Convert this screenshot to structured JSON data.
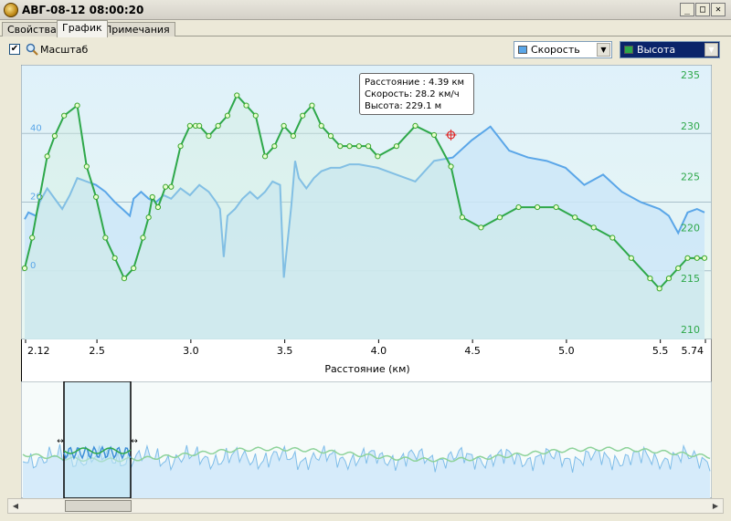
{
  "window": {
    "title": "АВГ-08-12 08:00:20"
  },
  "tabs": [
    {
      "label": "Свойства",
      "active": false
    },
    {
      "label": "График",
      "active": true
    },
    {
      "label": "Примечания",
      "active": false
    }
  ],
  "toolbar": {
    "scale_checked": true,
    "scale_label": "Масштаб",
    "speed_select": "Скорость",
    "height_select": "Высота"
  },
  "colors": {
    "speed": "#5aa6e8",
    "height": "#2ea84a",
    "bg_top": "#dff1fa",
    "bg_bottom": "#e9f7f2"
  },
  "tooltip": {
    "distance": "Расстояние : 4.39 км",
    "speed": "Скорость: 28.2 км/ч",
    "height": "Высота: 229.1 м"
  },
  "chart_data": {
    "type": "line",
    "xlabel": "Расстояние  (км)",
    "xlim": [
      2.12,
      5.74
    ],
    "x_ticks": [
      "2.12",
      "2.5",
      "3.0",
      "3.5",
      "4.0",
      "4.5",
      "5.0",
      "5.5",
      "5.74"
    ],
    "y_left_ticks": [
      "40",
      "20",
      "0"
    ],
    "y_right_ticks": [
      "235",
      "230",
      "225",
      "220",
      "215",
      "210"
    ],
    "y_left_lim": [
      -20,
      60
    ],
    "y_right_lim": [
      209,
      236
    ],
    "series": [
      {
        "name": "Скорость",
        "axis": "left",
        "x": [
          2.12,
          2.14,
          2.18,
          2.2,
          2.24,
          2.28,
          2.32,
          2.36,
          2.4,
          2.45,
          2.5,
          2.55,
          2.6,
          2.64,
          2.68,
          2.7,
          2.74,
          2.78,
          2.82,
          2.86,
          2.9,
          2.95,
          3.0,
          3.05,
          3.1,
          3.14,
          3.16,
          3.18,
          3.2,
          3.24,
          3.28,
          3.32,
          3.36,
          3.4,
          3.44,
          3.48,
          3.5,
          3.54,
          3.56,
          3.58,
          3.62,
          3.66,
          3.7,
          3.75,
          3.8,
          3.85,
          3.9,
          4.0,
          4.1,
          4.2,
          4.3,
          4.4,
          4.5,
          4.6,
          4.7,
          4.8,
          4.9,
          5.0,
          5.1,
          5.2,
          5.3,
          5.4,
          5.5,
          5.55,
          5.6,
          5.65,
          5.7,
          5.74
        ],
        "values": [
          15,
          17,
          16,
          20,
          24,
          21,
          18,
          22,
          27,
          26,
          25,
          23,
          20,
          18,
          16,
          21,
          23,
          21,
          20,
          22,
          21,
          24,
          22,
          25,
          23,
          20,
          18,
          4,
          16,
          18,
          21,
          23,
          21,
          23,
          26,
          25,
          -2,
          19,
          32,
          27,
          24,
          27,
          29,
          30,
          30,
          31,
          31,
          30,
          28,
          26,
          32,
          33,
          38,
          42,
          35,
          33,
          32,
          30,
          25,
          28,
          23,
          20,
          18,
          16,
          11,
          17,
          18,
          17
        ]
      },
      {
        "name": "Высота",
        "axis": "right",
        "x": [
          2.12,
          2.16,
          2.2,
          2.24,
          2.28,
          2.33,
          2.4,
          2.45,
          2.5,
          2.55,
          2.6,
          2.65,
          2.7,
          2.75,
          2.78,
          2.8,
          2.83,
          2.87,
          2.9,
          2.95,
          3.0,
          3.03,
          3.05,
          3.1,
          3.15,
          3.2,
          3.25,
          3.3,
          3.35,
          3.4,
          3.45,
          3.5,
          3.55,
          3.6,
          3.65,
          3.7,
          3.75,
          3.8,
          3.85,
          3.9,
          3.95,
          4.0,
          4.1,
          4.2,
          4.3,
          4.39,
          4.45,
          4.55,
          4.65,
          4.75,
          4.85,
          4.95,
          5.05,
          5.15,
          5.25,
          5.35,
          5.45,
          5.5,
          5.55,
          5.6,
          5.65,
          5.7,
          5.74
        ],
        "values": [
          216,
          219,
          223,
          227,
          229,
          231,
          232,
          226,
          223,
          219,
          217,
          215,
          216,
          219,
          221,
          223,
          222,
          224,
          224,
          228,
          230,
          230,
          230,
          229,
          230,
          231,
          233,
          232,
          231,
          227,
          228,
          230,
          229,
          231,
          232,
          230,
          229,
          228,
          228,
          228,
          228,
          227,
          228,
          230,
          229.1,
          226,
          221,
          220,
          221,
          222,
          222,
          222,
          221,
          220,
          219,
          217,
          215,
          214,
          215,
          216,
          217,
          217,
          217
        ]
      }
    ]
  },
  "overview": {
    "window_start": 2.12,
    "window_end": 2.73
  }
}
